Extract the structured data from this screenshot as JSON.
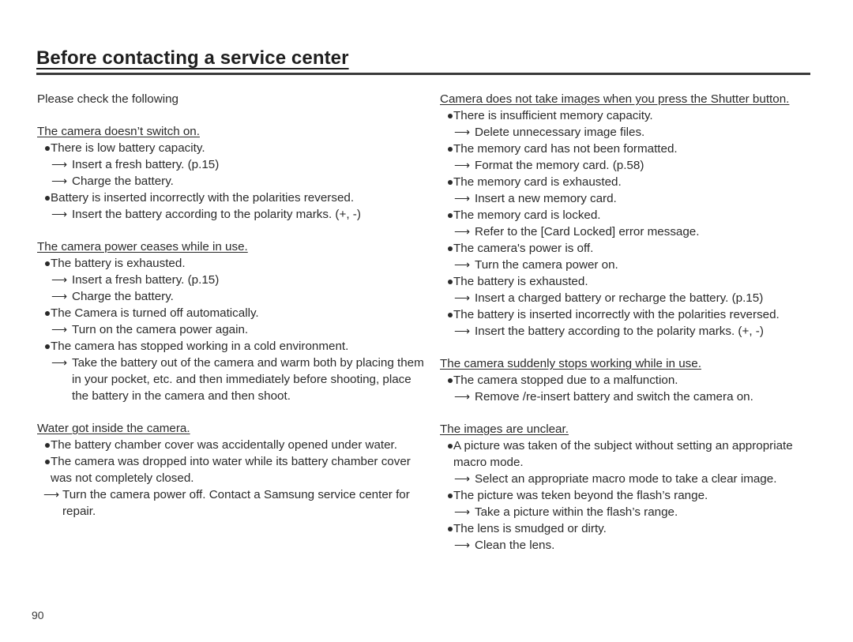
{
  "title": "Before contacting a service center",
  "intro": "Please check the following",
  "left_sections": [
    {
      "heading": "The camera doesn’t switch on.",
      "causes": [
        {
          "text": "There is low battery capacity.",
          "fixes": [
            "Insert a fresh battery. (p.15)",
            "Charge the battery."
          ]
        },
        {
          "text": "Battery is inserted incorrectly with the polarities reversed.",
          "fixes": [
            "Insert the battery according to the polarity marks. (+, -)"
          ]
        }
      ]
    },
    {
      "heading": "The camera power ceases while in use.",
      "causes": [
        {
          "text": "The battery is exhausted.",
          "fixes": [
            "Insert a fresh battery. (p.15)",
            "Charge the battery."
          ]
        },
        {
          "text": "The Camera is turned off automatically.",
          "fixes": [
            "Turn on the camera power again."
          ]
        },
        {
          "text": "The camera has stopped working in a cold environment.",
          "fixes": [
            "Take the battery out of the camera and warm both by placing them in your pocket, etc. and then immediately before shooting, place the battery in the camera and then shoot."
          ]
        }
      ]
    },
    {
      "heading": "Water got inside the camera.",
      "causes": [
        {
          "text": "The battery chamber cover was accidentally opened under water.",
          "fixes": []
        },
        {
          "text": "The camera was dropped into water while its battery chamber cover was not completely closed.",
          "fixes": []
        }
      ],
      "trailing_fix": "Turn the camera power off. Contact a Samsung service center for repair."
    }
  ],
  "right_sections": [
    {
      "heading": "Camera does not take images when you press the Shutter button.",
      "causes": [
        {
          "text": "There is insufficient memory capacity.",
          "fixes": [
            "Delete unnecessary image files."
          ]
        },
        {
          "text": "The memory card has not been formatted.",
          "fixes": [
            "Format the memory card. (p.58)"
          ]
        },
        {
          "text": "The memory card is exhausted.",
          "fixes": [
            "Insert a new memory card."
          ]
        },
        {
          "text": "The memory card is locked.",
          "fixes": [
            "Refer to the [Card Locked] error message."
          ]
        },
        {
          "text": "The camera's power is off.",
          "fixes": [
            "Turn the camera power on."
          ]
        },
        {
          "text": "The battery is exhausted.",
          "fixes": [
            "Insert a charged battery or recharge the battery. (p.15)"
          ]
        },
        {
          "text": "The battery is inserted incorrectly with the polarities reversed.",
          "fixes": [
            "Insert the battery according to the polarity marks. (+, -)"
          ]
        }
      ]
    },
    {
      "heading": "The camera suddenly stops working while in use.",
      "causes": [
        {
          "text": "The camera stopped due to a malfunction.",
          "fixes": [
            "Remove /re-insert battery and switch the camera on."
          ]
        }
      ]
    },
    {
      "heading": "The images are unclear.",
      "causes": [
        {
          "text": "A picture was taken of the subject without setting an appropriate macro mode.",
          "fixes": [
            "Select an appropriate macro mode to take a clear image."
          ]
        },
        {
          "text": "The picture was teken beyond the flash’s range.",
          "fixes": [
            "Take a picture within the flash’s range."
          ]
        },
        {
          "text": "The lens is smudged or dirty.",
          "fixes": [
            "Clean the lens."
          ]
        }
      ]
    }
  ],
  "glyphs": {
    "bullet": "bullet-dot",
    "arrow": "⟶"
  },
  "page_number": "90"
}
